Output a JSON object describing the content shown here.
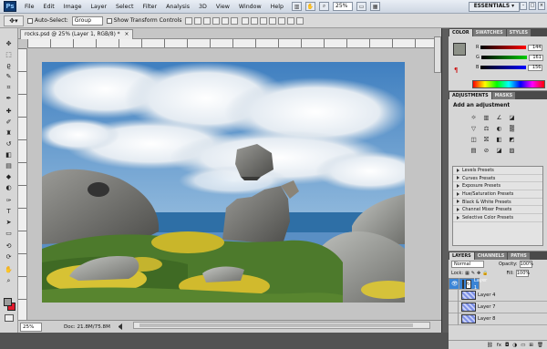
{
  "app": {
    "logo": "Ps"
  },
  "menubar": {
    "items": [
      "File",
      "Edit",
      "Image",
      "Layer",
      "Select",
      "Filter",
      "Analysis",
      "3D",
      "View",
      "Window",
      "Help"
    ],
    "zoom": "25%",
    "workspace": "ESSENTIALS",
    "workspace_arrow": "▾"
  },
  "options": {
    "auto_select_label": "Auto-Select:",
    "auto_select_value": "Group",
    "transform_controls_label": "Show Transform Controls"
  },
  "document": {
    "tab_title": "rocks.psd @ 25% (Layer 1, RGB/8) *",
    "tab_close": "×",
    "status_zoom": "25%",
    "status_doc": "Doc: 21.8M/75.8M"
  },
  "panels": {
    "color_tabs": [
      "COLOR",
      "SWATCHES",
      "STYLES"
    ],
    "color_rows": [
      {
        "label": "R",
        "value": "144",
        "gradient": "linear-gradient(90deg,#000,#f00)"
      },
      {
        "label": "G",
        "value": "161",
        "gradient": "linear-gradient(90deg,#000,#0c0)"
      },
      {
        "label": "B",
        "value": "156",
        "gradient": "linear-gradient(90deg,#000,#00f)"
      }
    ],
    "adjust_tabs": [
      "ADJUSTMENTS",
      "MASKS"
    ],
    "adjust_title": "Add an adjustment",
    "adjust_icons": [
      "☼",
      "▥",
      "∠",
      "◪",
      "▽",
      "⚖",
      "◐",
      "▒",
      "◫",
      "⛝",
      "◧",
      "◩",
      "▤",
      "⊘",
      "◪",
      "▨"
    ],
    "presets": [
      "Levels Presets",
      "Curves Presets",
      "Exposure Presets",
      "Hue/Saturation Presets",
      "Black & White Presets",
      "Channel Mixer Presets",
      "Selective Color Presets"
    ],
    "layers_tabs": [
      "LAYERS",
      "CHANNELS",
      "PATHS"
    ],
    "blend_mode": "Normal",
    "opacity_label": "Opacity:",
    "opacity": "100%",
    "lock_label": "Lock:",
    "fill_label": "Fill:",
    "fill": "100%",
    "layers": [
      {
        "name": "Layer 1",
        "selected": true
      },
      {
        "name": "Layer 4",
        "selected": false
      },
      {
        "name": "Layer 7",
        "selected": false
      },
      {
        "name": "Layer 8",
        "selected": false
      }
    ],
    "mask_marker": "↻",
    "layers_footer": [
      "⛓",
      "fx",
      "◘",
      "◑",
      "▭",
      "⊞",
      "🗑"
    ]
  },
  "colors": {
    "accent": "#3a84d6",
    "foreground": "#8d9188",
    "background": "#d11b25"
  }
}
